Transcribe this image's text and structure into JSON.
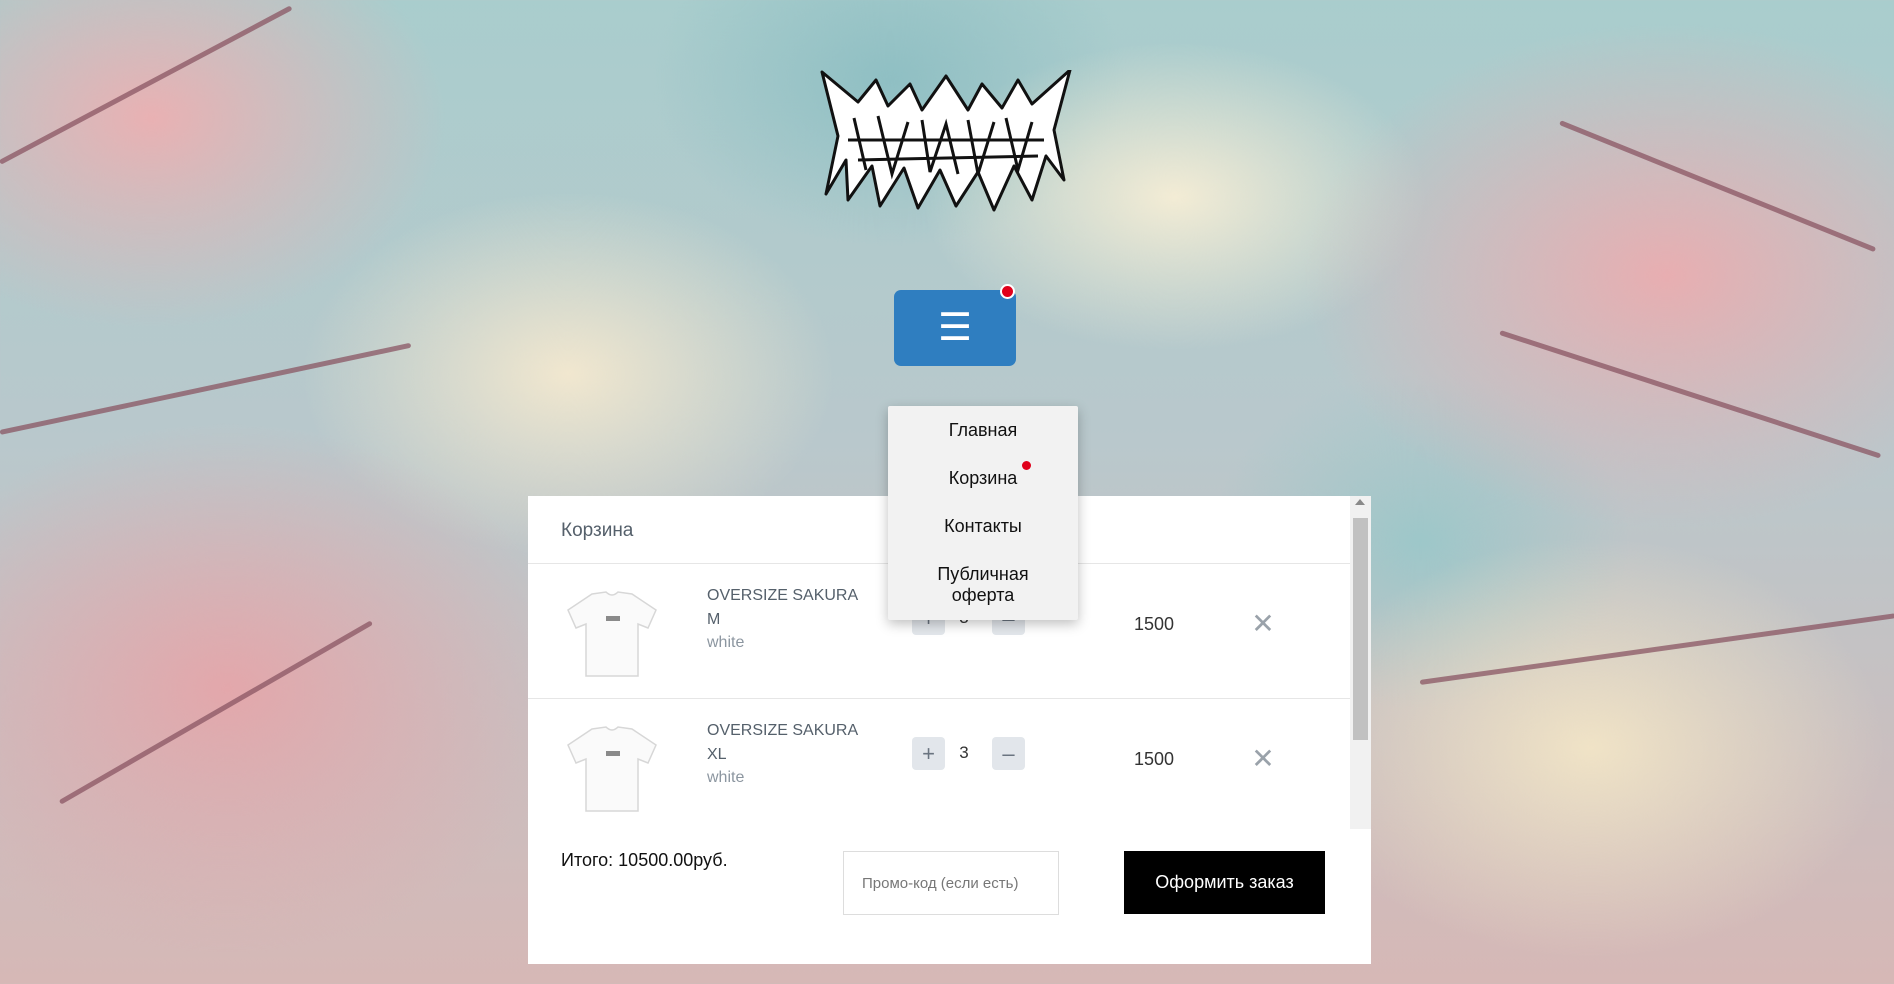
{
  "header": {
    "logo_alt": "brand logo",
    "menu_icon": "☰",
    "menu_icon_name": "hamburger-icon",
    "accent_color": "#2f7ec0",
    "notification_color": "#e0001b"
  },
  "nav": {
    "items": [
      {
        "label": "Главная"
      },
      {
        "label": "Корзина",
        "has_dot": true
      },
      {
        "label": "Контакты"
      },
      {
        "label": "Публичная оферта"
      }
    ]
  },
  "cart": {
    "title": "Корзина",
    "items": [
      {
        "name": "OVERSIZE SAKURA",
        "size": "M",
        "color": "white",
        "qty": "3",
        "price": "1500",
        "plus": "+",
        "minus": "–",
        "remove": "✕"
      },
      {
        "name": "OVERSIZE SAKURA",
        "size": "XL",
        "color": "white",
        "qty": "3",
        "price": "1500",
        "plus": "+",
        "minus": "–",
        "remove": "✕"
      }
    ],
    "total": "Итого: 10500.00руб.",
    "promo_placeholder": "Промо-код (если есть)",
    "order_label": "Оформить заказ"
  }
}
